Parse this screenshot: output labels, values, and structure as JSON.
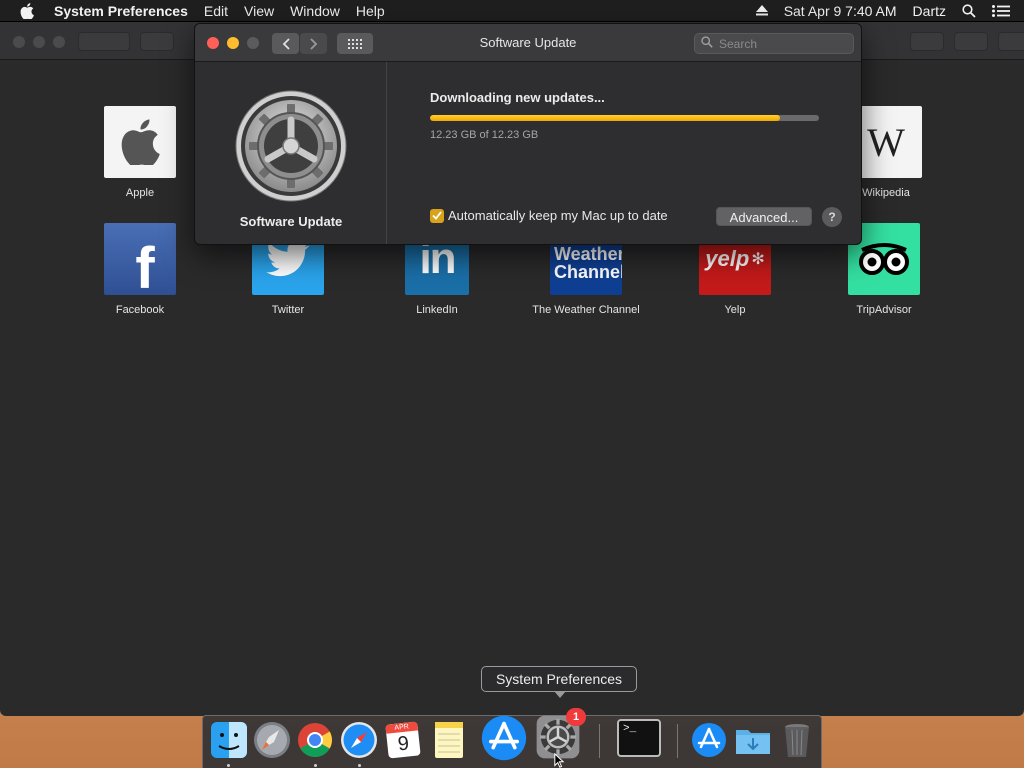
{
  "menubar": {
    "app_name": "System Preferences",
    "menus": [
      "Edit",
      "View",
      "Window",
      "Help"
    ],
    "datetime": "Sat Apr 9  7:40 AM",
    "user": "Dartz"
  },
  "favorites": [
    {
      "label": "Apple",
      "icon": "apple-icon"
    },
    {
      "label": "Wikipedia",
      "icon": "wikipedia-icon"
    },
    {
      "label": "Facebook",
      "icon": "facebook-icon"
    },
    {
      "label": "Twitter",
      "icon": "twitter-icon"
    },
    {
      "label": "LinkedIn",
      "icon": "linkedin-icon"
    },
    {
      "label": "The Weather Channel",
      "icon": "weather-channel-icon"
    },
    {
      "label": "Yelp",
      "icon": "yelp-icon"
    },
    {
      "label": "TripAdvisor",
      "icon": "tripadvisor-icon"
    }
  ],
  "software_update": {
    "title": "Software Update",
    "search_placeholder": "Search",
    "pane_label": "Software Update",
    "status": "Downloading new updates...",
    "progress_fraction": 0.9,
    "size_text": "12.23 GB of 12.23 GB",
    "auto_update_label": "Automatically keep my Mac up to date",
    "auto_update_checked": true,
    "advanced_label": "Advanced...",
    "help_label": "?"
  },
  "tooltip": "System Preferences",
  "dock": {
    "badge": "1",
    "calendar_month": "APR",
    "calendar_day": "9",
    "items": [
      "finder-icon",
      "launchpad-icon",
      "chrome-icon",
      "safari-icon",
      "calendar-icon",
      "notes-icon",
      "app-store-icon",
      "system-preferences-icon",
      "terminal-icon",
      "app-store-folder-icon",
      "downloads-folder-icon",
      "trash-icon"
    ]
  },
  "colors": {
    "progress": "#f5b400",
    "close": "#ff5f57",
    "minimize": "#febc2e",
    "badge": "#f0393a"
  }
}
